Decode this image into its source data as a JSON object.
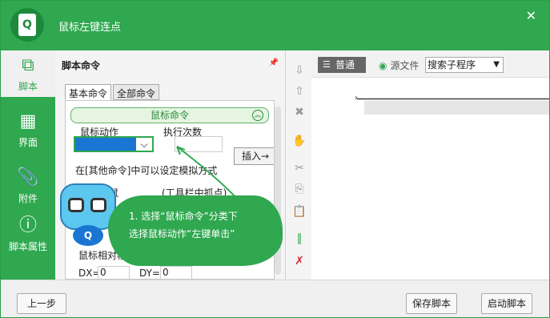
{
  "window": {
    "title": "鼠标左键连点"
  },
  "nav": [
    {
      "label": "脚本",
      "icon": "script-icon",
      "active": true
    },
    {
      "label": "界面",
      "icon": "interface-icon",
      "active": false
    },
    {
      "label": "附件",
      "icon": "attachment-icon",
      "active": false
    },
    {
      "label": "脚本属性",
      "icon": "info-icon",
      "active": false
    }
  ],
  "panel": {
    "header": "脚本命令",
    "tabs": [
      "基本命令",
      "全部命令"
    ],
    "group_title": "鼠标命令",
    "action_label": "鼠标动作",
    "exec_count_label": "执行次数",
    "insert_button": "插入→",
    "hint": "在[其他命令]中可以设定模拟方式",
    "row2_left": "鼠",
    "row2_right": "(工具栏中抓点)",
    "relative_label": "鼠标相对移动",
    "dx_label": "DX=",
    "dx_value": "0",
    "dy_label": "DY=",
    "dy_value": "0"
  },
  "editor": {
    "mode_button": "普通",
    "source_label": "源文件",
    "search_select": "搜索子程序"
  },
  "tooltip": {
    "line1": "1. 选择“鼠标命令”分类下",
    "line2": "选择鼠标动作“左键单击”"
  },
  "footer": {
    "prev": "上一步",
    "save": "保存脚本",
    "start": "启动脚本"
  },
  "colors": {
    "brand_green": "#2fa84f",
    "select_blue": "#1a76d2"
  }
}
